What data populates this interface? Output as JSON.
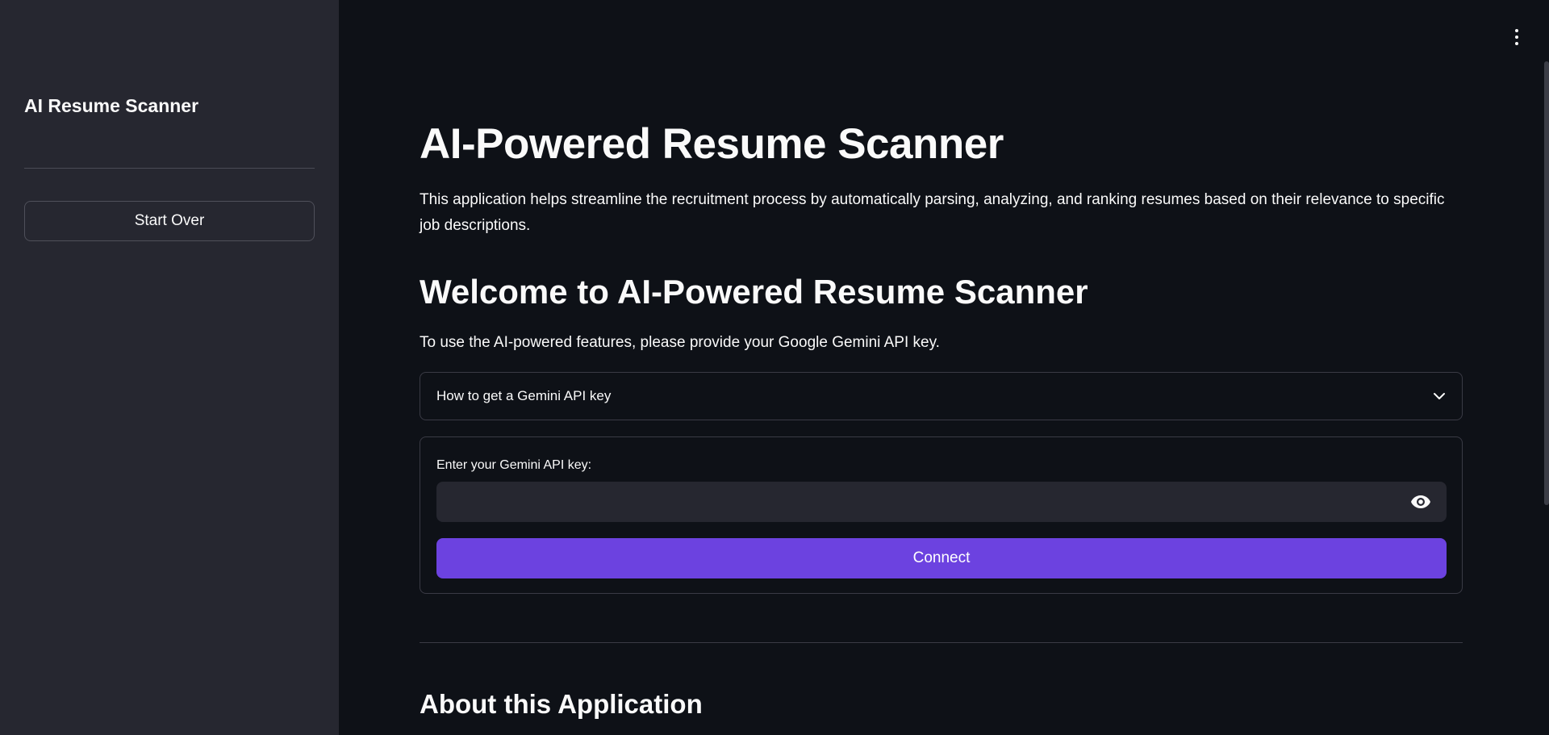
{
  "sidebar": {
    "title": "AI Resume Scanner",
    "start_over_label": "Start Over"
  },
  "header": {
    "menu_icon": "kebab-menu-icon"
  },
  "main": {
    "title": "AI-Powered Resume Scanner",
    "intro": "This application helps streamline the recruitment process by automatically parsing, analyzing, and ranking resumes based on their relevance to specific job descriptions.",
    "welcome_heading": "Welcome to AI-Powered Resume Scanner",
    "instructions": "To use the AI-powered features, please provide your Google Gemini API key.",
    "expander_label": "How to get a Gemini API key",
    "api_form": {
      "label": "Enter your Gemini API key:",
      "value": "",
      "placeholder": "",
      "toggle_icon": "eye-icon",
      "connect_label": "Connect"
    },
    "about_heading": "About this Application"
  },
  "colors": {
    "background": "#0e1117",
    "sidebar": "#262730",
    "accent": "#6c42e0",
    "text": "#fafafa"
  }
}
